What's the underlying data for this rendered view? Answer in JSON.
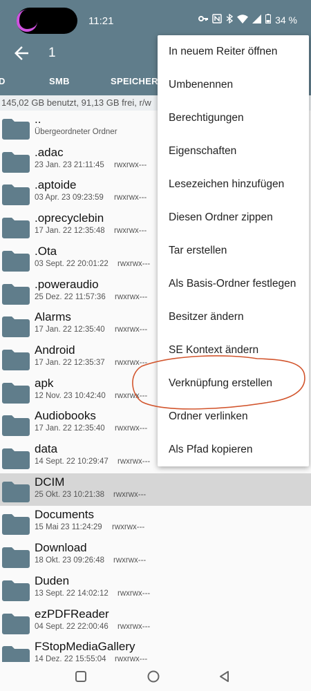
{
  "status_bar": {
    "time": "11:21",
    "battery": "34 %",
    "icons": [
      "key-icon",
      "nfc-icon",
      "bluetooth-icon",
      "wifi-icon",
      "signal-icon",
      "battery-icon"
    ]
  },
  "toolbar": {
    "path": "1"
  },
  "tabs": [
    "D",
    "SMB",
    "SPEICHER"
  ],
  "storage_info": "145,02 GB benutzt, 91,13 GB frei, r/w",
  "files": [
    {
      "name": "..",
      "date": "Übergeordneter Ordner",
      "perm": ""
    },
    {
      "name": ".adac",
      "date": "23 Jan. 23 21:11:45",
      "perm": "rwxrwx---"
    },
    {
      "name": ".aptoide",
      "date": "03 Apr. 23 09:23:59",
      "perm": "rwxrwx---"
    },
    {
      "name": ".oprecyclebin",
      "date": "17 Jan. 22 12:35:48",
      "perm": "rwxrwx---"
    },
    {
      "name": ".Ota",
      "date": "03 Sept. 22 20:01:22",
      "perm": "rwxrwx---"
    },
    {
      "name": ".poweraudio",
      "date": "25 Dez. 22 11:57:36",
      "perm": "rwxrwx---"
    },
    {
      "name": "Alarms",
      "date": "17 Jan. 22 12:35:40",
      "perm": "rwxrwx---"
    },
    {
      "name": "Android",
      "date": "17 Jan. 22 12:35:37",
      "perm": "rwxrwx---"
    },
    {
      "name": "apk",
      "date": "12 Nov. 23 10:42:40",
      "perm": "rwxrwx---"
    },
    {
      "name": "Audiobooks",
      "date": "17 Jan. 22 12:35:40",
      "perm": "rwxrwx---"
    },
    {
      "name": "data",
      "date": "14 Sept. 22 10:29:47",
      "perm": "rwxrwx---"
    },
    {
      "name": "DCIM",
      "date": "25 Okt. 23 10:21:38",
      "perm": "rwxrwx---",
      "selected": true
    },
    {
      "name": "Documents",
      "date": "15 Mai 23 11:24:29",
      "perm": "rwxrwx---"
    },
    {
      "name": "Download",
      "date": "18 Okt. 23 09:26:48",
      "perm": "rwxrwx---"
    },
    {
      "name": "Duden",
      "date": "13 Sept. 22 14:02:12",
      "perm": "rwxrwx---"
    },
    {
      "name": "ezPDFReader",
      "date": "04 Sept. 22 22:00:46",
      "perm": "rwxrwx---"
    },
    {
      "name": "FStopMediaGallery",
      "date": "14 Dez. 22 15:55:04",
      "perm": "rwxrwx---"
    }
  ],
  "menu": [
    "In neuem Reiter öffnen",
    "Umbenennen",
    "Berechtigungen",
    "Eigenschaften",
    "Lesezeichen hinzufügen",
    "Diesen Ordner zippen",
    "Tar erstellen",
    "Als Basis-Ordner festlegen",
    "Besitzer ändern",
    "SE Kontext ändern",
    "Verknüpfung erstellen",
    "Ordner verlinken",
    "Als Pfad kopieren"
  ],
  "colors": {
    "primary": "#607d8b",
    "folder": "#607d8b",
    "selected_row": "#d6d6d6",
    "annotation": "#d2552d"
  }
}
